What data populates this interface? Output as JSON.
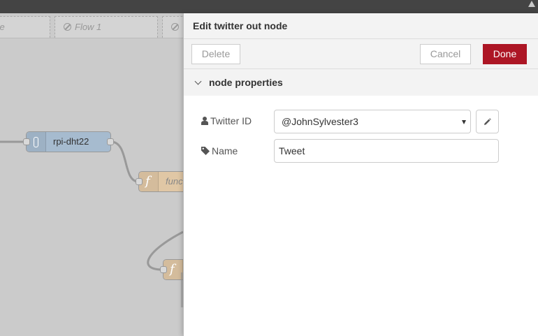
{
  "workspace": {
    "tabs": [
      {
        "label": "ce",
        "disabled": true
      },
      {
        "label": "Flow 1",
        "disabled": true
      },
      {
        "label": "",
        "disabled": true
      }
    ],
    "nodes": [
      {
        "label": "rpi-dht22",
        "color": "#a6bbcf",
        "icon": "thermometer-icon"
      },
      {
        "label": "func",
        "color": "#e0c7a5",
        "icon": "function-icon"
      },
      {
        "label": "",
        "color": "#e0c7a5",
        "icon": "function-icon"
      }
    ]
  },
  "tray": {
    "title": "Edit twitter out node",
    "buttons": {
      "delete": "Delete",
      "cancel": "Cancel",
      "done": "Done"
    },
    "section": {
      "title": "node properties",
      "expanded": true
    },
    "fields": {
      "twitter_id": {
        "label": "Twitter ID",
        "icon": "user-icon",
        "value": "@JohnSylvester3"
      },
      "name": {
        "label": "Name",
        "icon": "tag-icon",
        "value": "Tweet"
      }
    }
  },
  "colors": {
    "done_button": "#ad1625",
    "header": "#444444"
  }
}
